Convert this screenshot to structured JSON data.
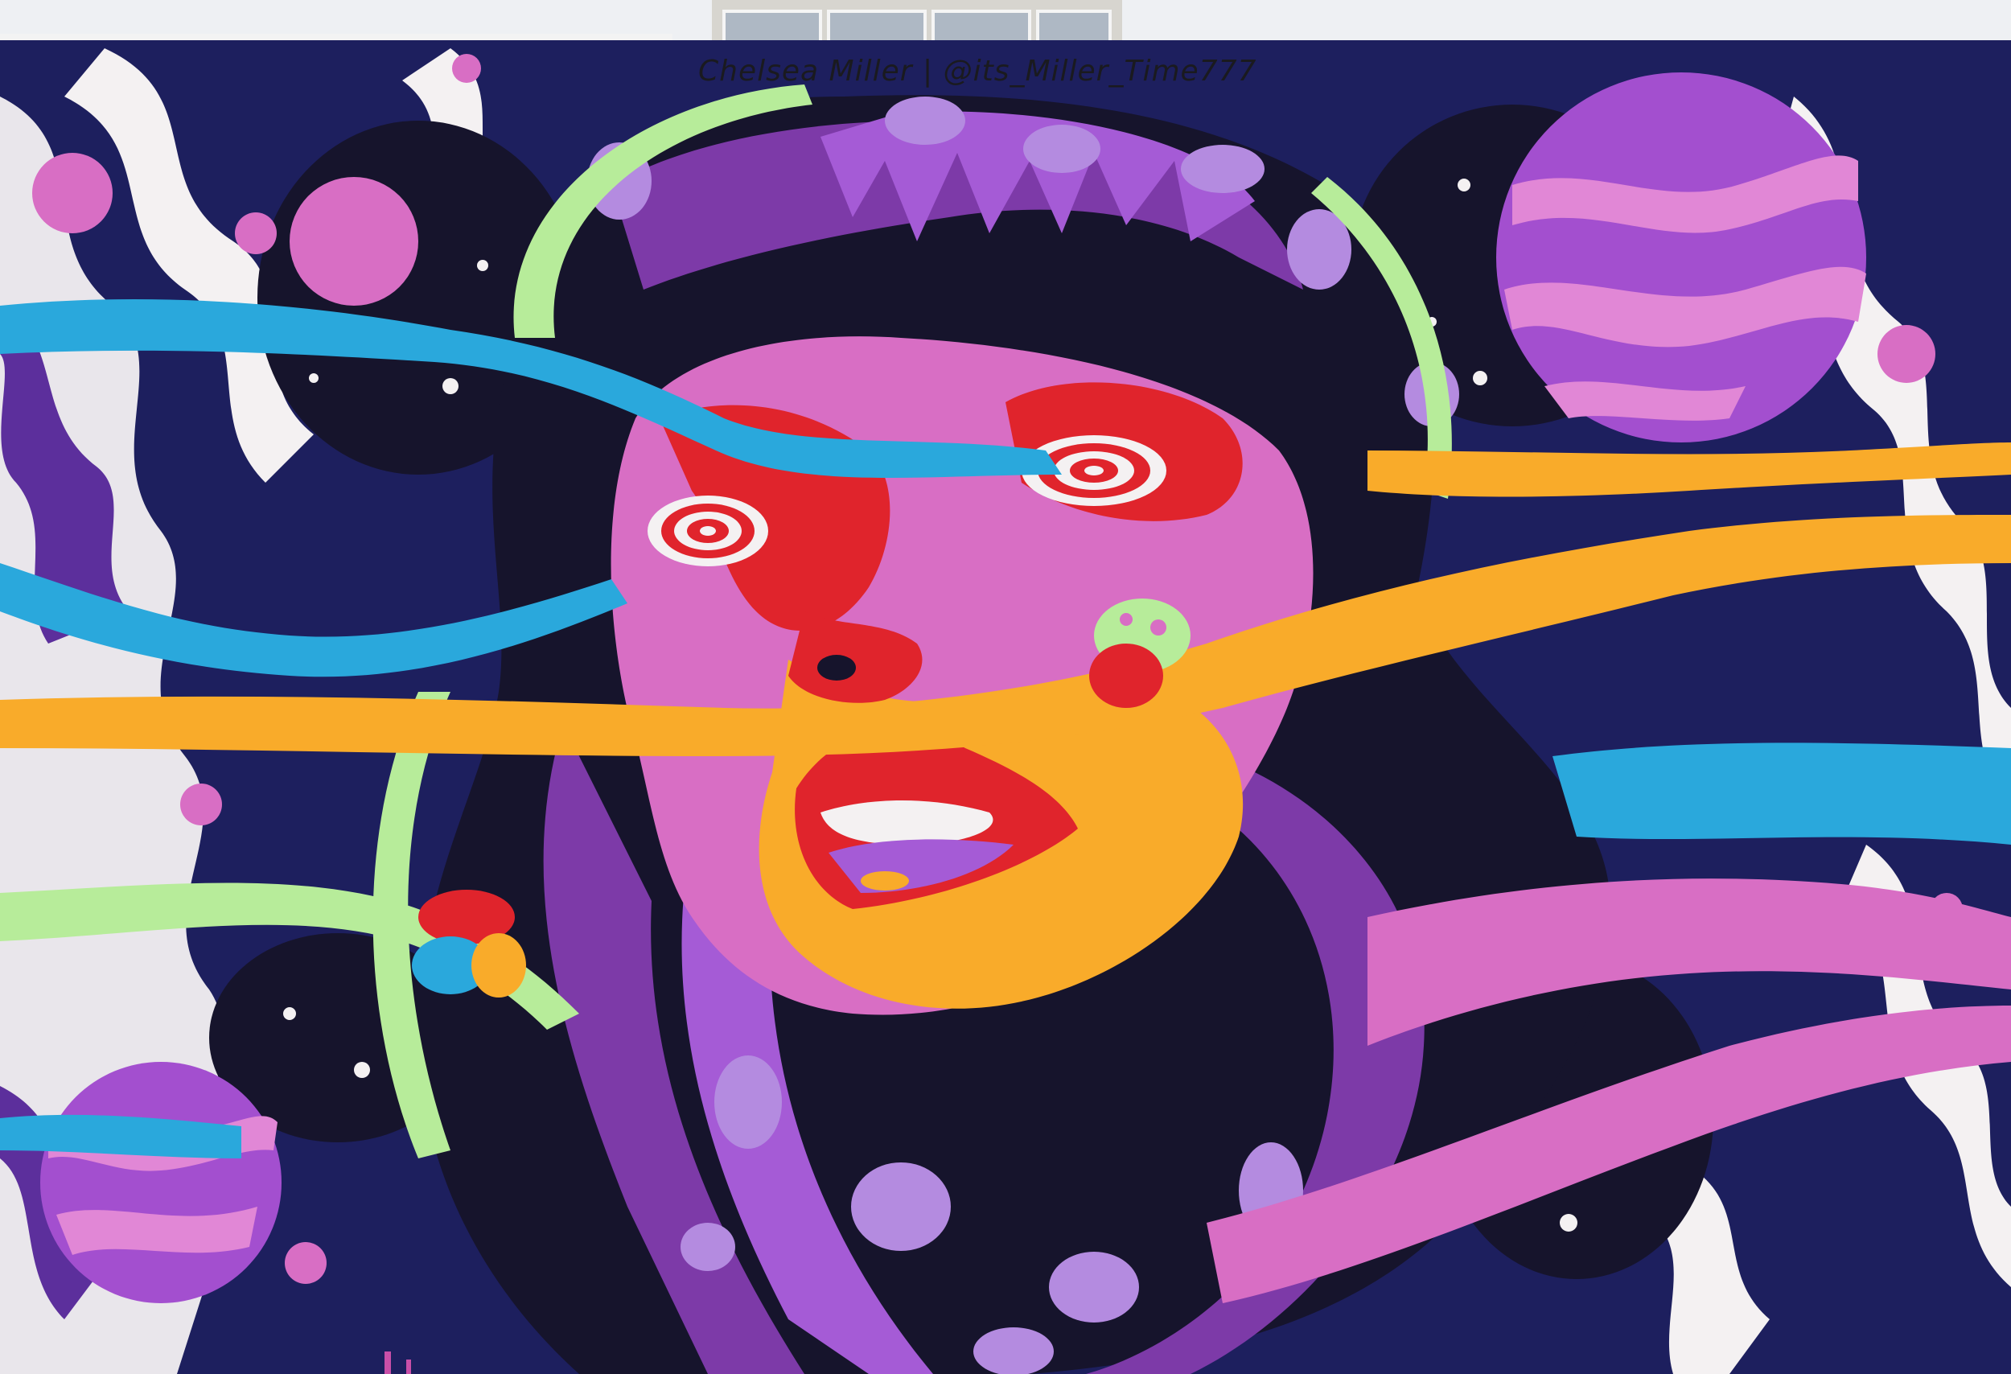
{
  "signature": {
    "artist": "Chelsea Miller",
    "separator": "|",
    "handle": "@its_Miller_Time777"
  },
  "colors": {
    "navy": "#1d1f5e",
    "dark": "#16142c",
    "purple": "#7d3aa8",
    "violet": "#a55bd6",
    "lavender": "#b48be0",
    "pink": "#d86ec4",
    "magenta": "#c94fa8",
    "cyan": "#2aa8dc",
    "orange": "#f9ab2a",
    "lime": "#b7ec9a",
    "red": "#e0242c",
    "white": "#f4f1f2",
    "sky": "#dfe5ee"
  }
}
